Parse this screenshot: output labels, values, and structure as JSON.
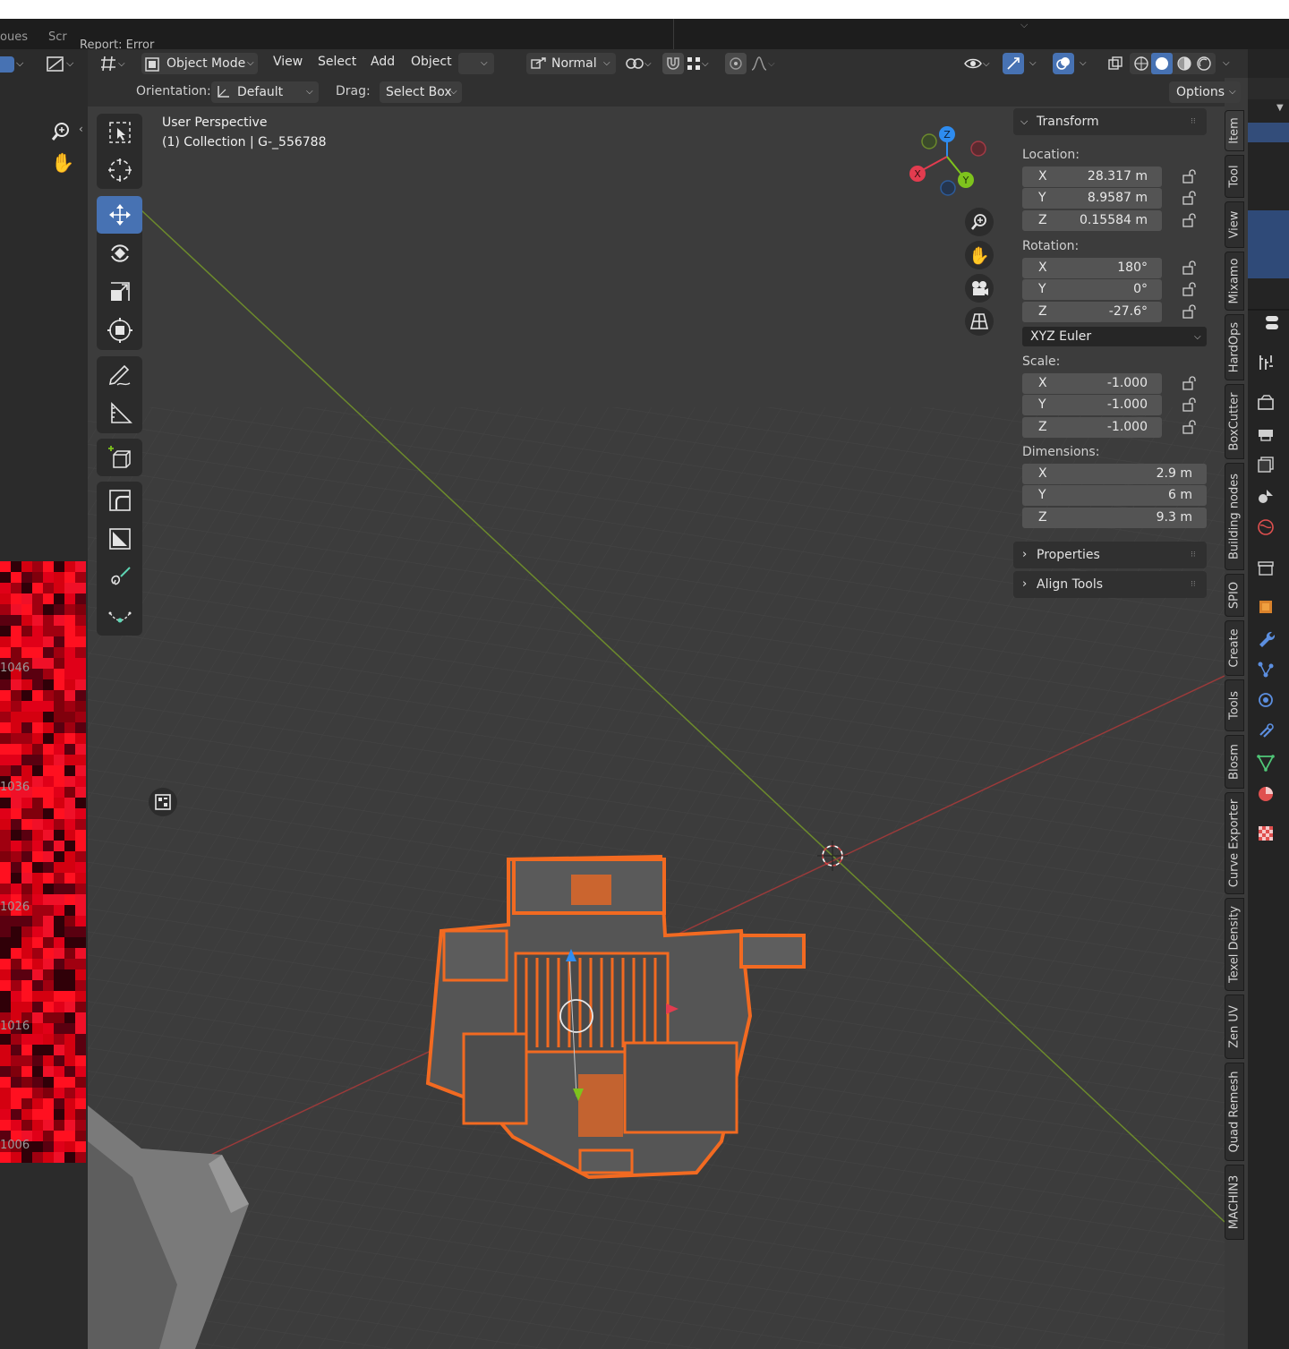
{
  "top": {
    "fragment_1": "oues",
    "fragment_2": "Scr",
    "report": "Report: Error"
  },
  "header": {
    "mode": "Object Mode",
    "menus": [
      "View",
      "Select",
      "Add",
      "Object"
    ],
    "transform_orientation_pivot": "Normal",
    "orientation_label": "Orientation:",
    "orientation_value": "Default",
    "drag_label": "Drag:",
    "drag_value": "Select Box",
    "options": "Options"
  },
  "viewport": {
    "perspective": "User Perspective",
    "collection": "(1) Collection | G-_556788",
    "gizmo": {
      "x": "X",
      "y": "Y",
      "z": "Z"
    }
  },
  "left_editor": {
    "row_labels": [
      "1046",
      "1036",
      "1026",
      "1016",
      "1006"
    ]
  },
  "npanel": {
    "transform_title": "Transform",
    "location_label": "Location:",
    "location": [
      {
        "axis": "X",
        "value": "28.317 m"
      },
      {
        "axis": "Y",
        "value": "8.9587 m"
      },
      {
        "axis": "Z",
        "value": "0.15584 m"
      }
    ],
    "rotation_label": "Rotation:",
    "rotation": [
      {
        "axis": "X",
        "value": "180°"
      },
      {
        "axis": "Y",
        "value": "0°"
      },
      {
        "axis": "Z",
        "value": "-27.6°"
      }
    ],
    "rotation_mode": "XYZ Euler",
    "scale_label": "Scale:",
    "scale": [
      {
        "axis": "X",
        "value": "-1.000"
      },
      {
        "axis": "Y",
        "value": "-1.000"
      },
      {
        "axis": "Z",
        "value": "-1.000"
      }
    ],
    "dimensions_label": "Dimensions:",
    "dimensions": [
      {
        "axis": "X",
        "value": "2.9 m"
      },
      {
        "axis": "Y",
        "value": "6 m"
      },
      {
        "axis": "Z",
        "value": "9.3 m"
      }
    ],
    "properties_title": "Properties",
    "align_tools_title": "Align Tools"
  },
  "tabs": [
    "Item",
    "Tool",
    "View",
    "Mixamo",
    "HardOps",
    "BoxCutter",
    "Building nodes",
    "SPIO",
    "Create",
    "Tools",
    "Blosm",
    "Curve Exporter",
    "Texel Density",
    "Zen UV",
    "Quad Remesh",
    "MACHIN3"
  ],
  "colors": {
    "accent": "#4772b3",
    "selection": "#f26a21",
    "x_axis": "#e23c4f",
    "y_axis": "#7ec31d",
    "z_axis": "#2e8cf0"
  }
}
